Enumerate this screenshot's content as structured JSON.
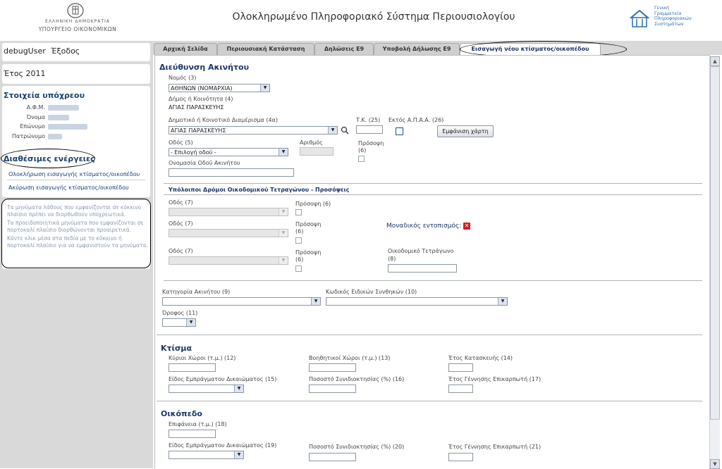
{
  "header": {
    "gov_line1": "ΕΛΛΗΝΙΚΗ ΔΗΜΟΚΡΑΤΙΑ",
    "gov_line2": "ΥΠΟΥΡΓΕΙΟ ΟΙΚΟΝΟΜΙΚΩΝ",
    "title": "Ολοκληρωμένο Πληροφοριακό Σύστημα Περιουσιολογίου",
    "logo_text": [
      "Γενική",
      "Γραμματεία",
      "Πληροφοριακών",
      "Συστημάτων"
    ]
  },
  "sidebar": {
    "user": "debugUser",
    "logout": "Έξοδος",
    "year": "Έτος 2011",
    "taxpayer_title": "Στοιχεία υπόχρεου",
    "taxpayer_fields": [
      {
        "label": "Α.Φ.Μ."
      },
      {
        "label": "Όνομα"
      },
      {
        "label": "Επώνυμο"
      },
      {
        "label": "Πατρώνυμο"
      }
    ],
    "actions_title": "Διαθέσιμες ενέργειες",
    "actions": [
      "Ολοκλήρωση εισαγωγής κτίσματος/οικοπέδου",
      "Ακύρωση εισαγωγής κτίσματος/οικοπέδου"
    ],
    "hints": [
      "Τα μηνύματα λάθους που εμφανίζονται σε κόκκινο πλαίσιο πρέπει να διορθωθούν υποχρεωτικά.",
      "Τα προειδοποιητικά μηνύματα που εμφανίζονται σε πορτοκαλί πλαίσιο διορθώνονται προαιρετικά.",
      "Κάντε κλικ μέσα στα πεδία με το κόκκινο ή πορτοκαλί πλαίσιο για να εμφανιστούν τα μηνύματα."
    ]
  },
  "tabs": [
    "Αρχική Σελίδα",
    "Περιουσιακή Κατάσταση",
    "Δηλώσεις Ε9",
    "Υποβολή Δήλωσης Ε9",
    "Εισαγωγή νέου κτίσματος/οικοπέδου"
  ],
  "address": {
    "title": "Διεύθυνση Ακινήτου",
    "nomos_label": "Νομός (3)",
    "nomos_value": "ΑΘΗΝΩΝ (ΝΟΜΑΡΧΙΑ)",
    "dimos_label": "Δήμος ή Κοινότητα (4)",
    "dimos_value": "ΑΓΙΑΣ ΠΑΡΑΣΚΕΥΗΣ",
    "diamerisma_label": "Δημοτικό ή Κοινοτικό Διαμέρισμα (4α)",
    "diamerisma_value": "ΑΓΙΑΣ ΠΑΡΑΣΚΕΥΗΣ",
    "tk_label": "Τ.Κ. (25)",
    "ektos_label": "Εκτός Α.Π.Α.Α. (26)",
    "map_button": "Εμφάνιση χάρτη",
    "odos_label": "Οδός (5)",
    "odos_value": "- Επιλογή οδού -",
    "arithmos_label": "Αριθμός",
    "prosopsi_label": "Πρόσοψη",
    "prosopsi_num": "(6)",
    "onomasia_label": "Ονομασία Οδού Ακινήτου"
  },
  "other_streets": {
    "title": "Υπόλοιποι Δρόμοι Οικοδομικού Τετραγώνου - Προσόψεις",
    "odos7": "Οδός (7)",
    "prosopsi6": "Πρόσοψη (6)",
    "prosopsi": "Πρόσοψη",
    "num6": "(6)",
    "unique_location": "Μοναδικός εντοπισμός:",
    "block_label": "Οικοδομικό Τετράγωνο",
    "block_num": "(8)"
  },
  "property": {
    "category_label": "Κατηγορία Ακινήτου (9)",
    "special_code_label": "Κωδικός Ειδικών Συνθηκών (10)",
    "floor_label": "Όροφος (11)"
  },
  "building": {
    "title": "Κτίσμα",
    "main_label": "Κύριοι Χώροι (τ.μ.) (12)",
    "aux_label": "Βοηθητικοί Χώροι (τ.μ.) (13)",
    "year_label": "Έτος Κατασκευής (14)",
    "right_label": "Είδος Εμπράγματου Δικαιώματος (15)",
    "share_label": "Ποσοστό Συνιδιοκτησίας (%) (16)",
    "usufruct_label": "Έτος Γέννησης Επικαρπωτή (17)"
  },
  "plot": {
    "title": "Οικόπεδο",
    "area_label": "Επιφάνεια (τ.μ.) (18)",
    "right_label": "Είδος Εμπράγματου Δικαιώματος (19)",
    "share_label": "Ποσοστό Συνιδιοκτησίας (%) (20)",
    "usufruct_label": "Έτος Γέννησης Επικαρπωτή (21)"
  }
}
